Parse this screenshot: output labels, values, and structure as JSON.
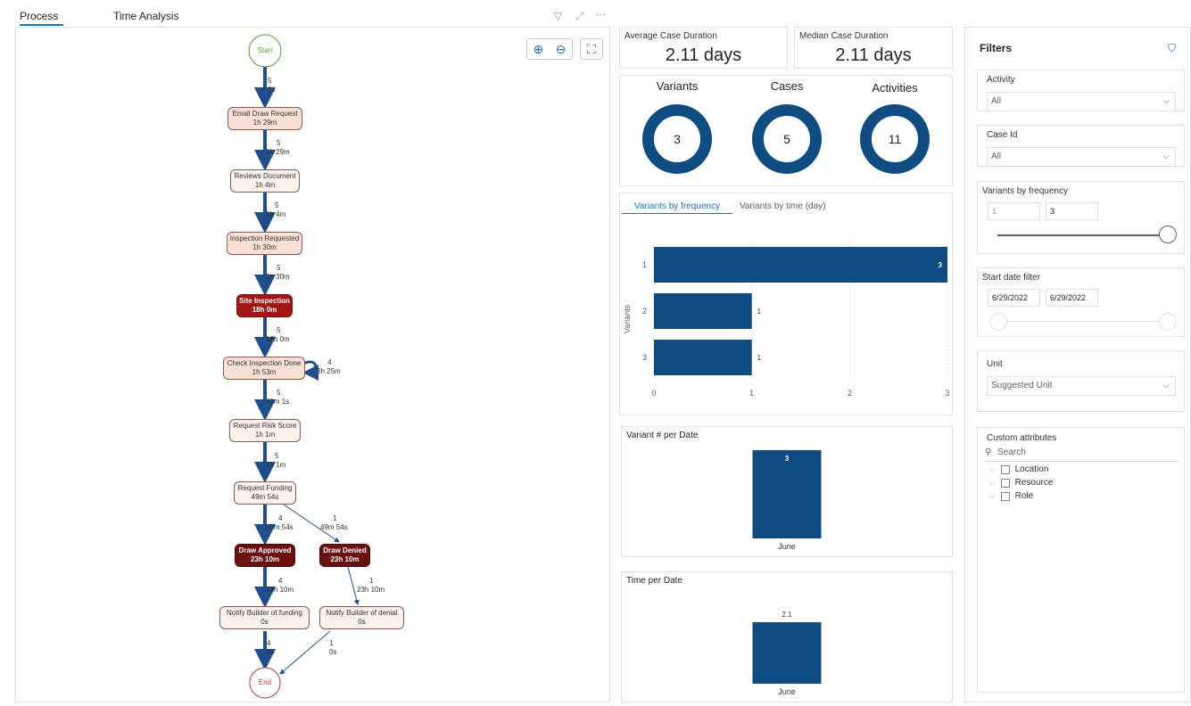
{
  "tabs": [
    {
      "label": "Process"
    },
    {
      "label": "Time Analysis"
    }
  ],
  "process_map": {
    "nodes": {
      "start": "Start",
      "end": "End",
      "email": {
        "name": "Email Draw Request",
        "duration": "1h 29m"
      },
      "reviews": {
        "name": "Reviews Document",
        "duration": "1h 4m"
      },
      "inspection_req": {
        "name": "Inspection Requested",
        "duration": "1h 30m"
      },
      "site": {
        "name": "Site Inspection",
        "duration": "18h 0m"
      },
      "check": {
        "name": "Check Inspection Done",
        "duration": "1h 53m"
      },
      "risk": {
        "name": "Request Risk Score",
        "duration": "1h 1m"
      },
      "funding": {
        "name": "Request Funding",
        "duration": "49m 54s"
      },
      "approved": {
        "name": "Draw Approved",
        "duration": "23h 10m"
      },
      "denied": {
        "name": "Draw Denied",
        "duration": "23h 10m"
      },
      "notify_funding": {
        "name": "Notify Builder of funding",
        "duration": "0s"
      },
      "notify_denial": {
        "name": "Notify Builder of denial",
        "duration": "0s"
      }
    },
    "edges": {
      "e1": {
        "count": "5",
        "time": "0s"
      },
      "e2": {
        "count": "5",
        "time": "1h 29m"
      },
      "e3": {
        "count": "5",
        "time": "1h 4m"
      },
      "e4": {
        "count": "5",
        "time": "1h 30m"
      },
      "e5": {
        "count": "5",
        "time": "18h 0m"
      },
      "loop": {
        "count": "4",
        "time": "3h 25m"
      },
      "e6": {
        "count": "5",
        "time": "41m 1s"
      },
      "e7": {
        "count": "5",
        "time": "1h 1m"
      },
      "e8": {
        "count": "4",
        "time": "49m 54s"
      },
      "e9": {
        "count": "1",
        "time": "49m 54s"
      },
      "e10": {
        "count": "4",
        "time": "23h 10m"
      },
      "e11": {
        "count": "1",
        "time": "23h 10m"
      },
      "e12": {
        "count": "4",
        "time": "0s"
      },
      "e13": {
        "count": "1",
        "time": "0s"
      }
    }
  },
  "kpis": {
    "avg": {
      "label": "Average Case Duration",
      "value": "2.11 days"
    },
    "median": {
      "label": "Median Case Duration",
      "value": "2.11 days"
    }
  },
  "donuts": [
    {
      "title": "Variants",
      "value": "3"
    },
    {
      "title": "Cases",
      "value": "5"
    },
    {
      "title": "Activities",
      "value": "11"
    }
  ],
  "variants_chart": {
    "tabs": [
      "Variants by frequency",
      "Variants by time (day)"
    ]
  },
  "chart_data": [
    {
      "type": "bar",
      "orientation": "horizontal",
      "categories": [
        "1",
        "2",
        "3"
      ],
      "values": [
        3,
        1,
        1
      ],
      "ylabel": "Variants",
      "xlim": [
        0,
        3
      ],
      "xticks": [
        "0",
        "1",
        "2",
        "3"
      ],
      "color": "#0f4c81"
    },
    {
      "type": "bar",
      "title": "Variant # per Date",
      "categories": [
        "June"
      ],
      "values": [
        3
      ],
      "color": "#0f4c81"
    },
    {
      "type": "bar",
      "title": "Time per Date",
      "categories": [
        "June"
      ],
      "values": [
        2.1
      ],
      "color": "#0f4c81"
    }
  ],
  "filters": {
    "title": "Filters",
    "activity": {
      "label": "Activity",
      "value": "All"
    },
    "case_id": {
      "label": "Case Id",
      "value": "All"
    },
    "variants_freq": {
      "label": "Variants by frequency",
      "min": "1",
      "max": "3"
    },
    "start_date": {
      "label": "Start date filter",
      "from": "6/29/2022",
      "to": "6/29/2022"
    },
    "unit": {
      "label": "Unit",
      "value": "Suggested Unit"
    },
    "custom": {
      "label": "Custom attributes",
      "search_placeholder": "Search",
      "items": [
        "Location",
        "Resource",
        "Role"
      ]
    }
  },
  "colors": {
    "accent": "#1b6ec2",
    "bar": "#0f4c81",
    "site": "#a31515",
    "approved": "#6b0f0f",
    "light_node": "#fbe0d6",
    "pale_node": "#fdf1ec"
  }
}
